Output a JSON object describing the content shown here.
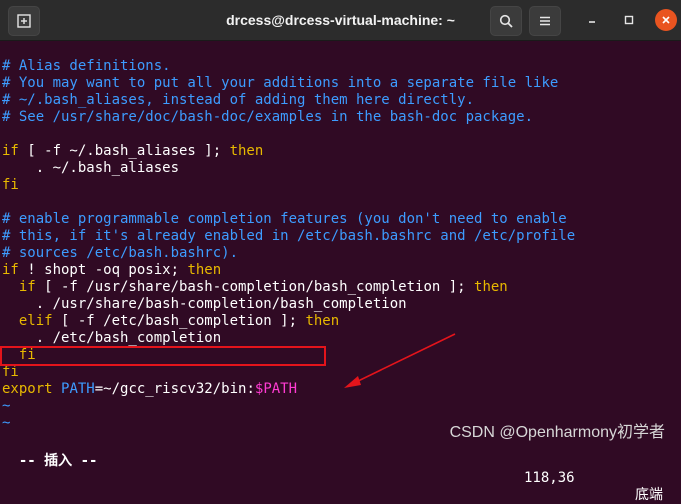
{
  "window": {
    "title": "drcess@drcess-virtual-machine: ~"
  },
  "terminal_lines": [
    {
      "segments": [
        {
          "t": "",
          "c": "p"
        }
      ]
    },
    {
      "segments": [
        {
          "t": "# Alias definitions.",
          "c": "c"
        }
      ]
    },
    {
      "segments": [
        {
          "t": "# You may want to put all your additions into a separate file like",
          "c": "c"
        }
      ]
    },
    {
      "segments": [
        {
          "t": "# ~/.bash_aliases, instead of adding them here directly.",
          "c": "c"
        }
      ]
    },
    {
      "segments": [
        {
          "t": "# See /usr/share/doc/bash-doc/examples in the bash-doc package.",
          "c": "c"
        }
      ]
    },
    {
      "segments": [
        {
          "t": "",
          "c": "p"
        }
      ]
    },
    {
      "segments": [
        {
          "t": "if",
          "c": "k"
        },
        {
          "t": " [ -f ~/.bash_aliases ]; ",
          "c": "p"
        },
        {
          "t": "then",
          "c": "k"
        }
      ]
    },
    {
      "segments": [
        {
          "t": "    . ~/.bash_aliases",
          "c": "p"
        }
      ]
    },
    {
      "segments": [
        {
          "t": "fi",
          "c": "k"
        }
      ]
    },
    {
      "segments": [
        {
          "t": "",
          "c": "p"
        }
      ]
    },
    {
      "segments": [
        {
          "t": "# enable programmable completion features (you don't need to enable",
          "c": "c"
        }
      ]
    },
    {
      "segments": [
        {
          "t": "# this, if it's already enabled in /etc/bash.bashrc and /etc/profile",
          "c": "c"
        }
      ]
    },
    {
      "segments": [
        {
          "t": "# sources /etc/bash.bashrc).",
          "c": "c"
        }
      ]
    },
    {
      "segments": [
        {
          "t": "if",
          "c": "k"
        },
        {
          "t": " ! shopt -oq posix; ",
          "c": "p"
        },
        {
          "t": "then",
          "c": "k"
        }
      ]
    },
    {
      "segments": [
        {
          "t": "  ",
          "c": "p"
        },
        {
          "t": "if",
          "c": "k"
        },
        {
          "t": " [ -f /usr/share/bash-completion/bash_completion ]; ",
          "c": "p"
        },
        {
          "t": "then",
          "c": "k"
        }
      ]
    },
    {
      "segments": [
        {
          "t": "    . /usr/share/bash-completion/bash_completion",
          "c": "p"
        }
      ]
    },
    {
      "segments": [
        {
          "t": "  ",
          "c": "p"
        },
        {
          "t": "elif",
          "c": "k"
        },
        {
          "t": " [ -f /etc/bash_completion ]; ",
          "c": "p"
        },
        {
          "t": "then",
          "c": "k"
        }
      ]
    },
    {
      "segments": [
        {
          "t": "    . /etc/bash_completion",
          "c": "p"
        }
      ]
    },
    {
      "segments": [
        {
          "t": "  ",
          "c": "p"
        },
        {
          "t": "fi",
          "c": "k"
        }
      ]
    },
    {
      "segments": [
        {
          "t": "fi",
          "c": "k"
        }
      ]
    },
    {
      "segments": [
        {
          "t": "export ",
          "c": "k"
        },
        {
          "t": "PATH",
          "c": "t"
        },
        {
          "t": "=~/gcc_riscv32/bin:",
          "c": "p"
        },
        {
          "t": "$PATH",
          "c": "v"
        }
      ]
    },
    {
      "segments": [
        {
          "t": "~",
          "c": "t"
        }
      ]
    },
    {
      "segments": [
        {
          "t": "~",
          "c": "t"
        }
      ]
    }
  ],
  "status": {
    "mode": "-- 插入 --",
    "position": "118,36",
    "scroll": "底端"
  },
  "watermark": "CSDN @Openharmony初学者",
  "colors": {
    "background": "#300a24",
    "comment": "#3d9cff",
    "keyword": "#e8b900",
    "variable": "#ff3bd2",
    "highlight_box": "#e4141b"
  }
}
